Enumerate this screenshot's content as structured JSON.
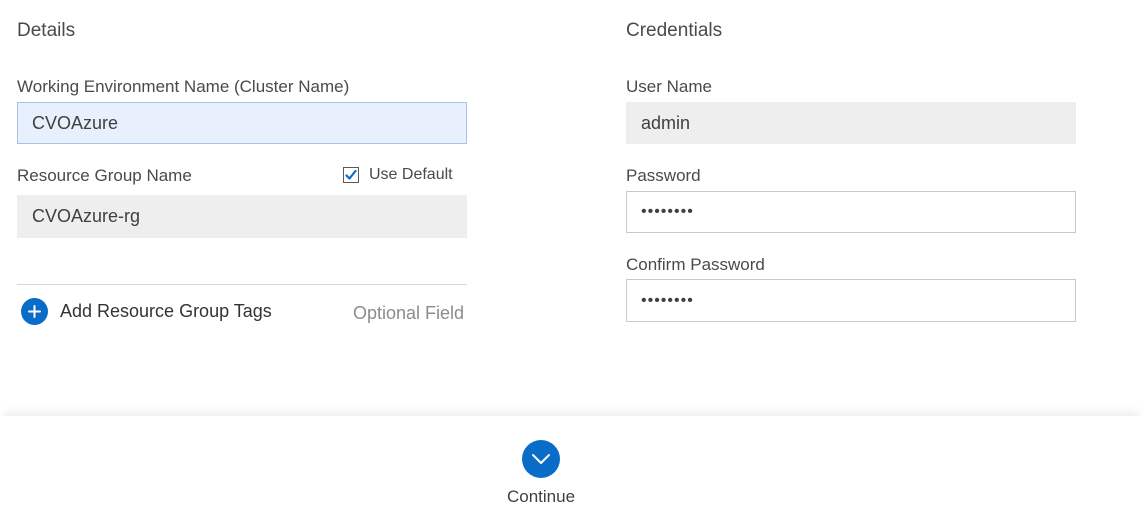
{
  "details": {
    "title": "Details",
    "working_env_label": "Working Environment Name (Cluster Name)",
    "working_env_value": "CVOAzure",
    "resource_group_label": "Resource Group Name",
    "use_default_label": "Use Default",
    "use_default_checked": true,
    "resource_group_value": "CVOAzure-rg",
    "add_tags_label": "Add Resource Group Tags",
    "optional_label": "Optional Field"
  },
  "credentials": {
    "title": "Credentials",
    "username_label": "User Name",
    "username_value": "admin",
    "password_label": "Password",
    "password_value": "••••••••",
    "confirm_password_label": "Confirm Password",
    "confirm_password_value": "••••••••"
  },
  "footer": {
    "continue_label": "Continue"
  },
  "colors": {
    "accent": "#0a6cc9",
    "active_field_bg": "#e8f0fd",
    "disabled_field_bg": "#eeeeee"
  },
  "icons": {
    "use_default_check": "checkmark-icon",
    "add_tags": "plus-circle-icon",
    "continue": "chevron-down-icon"
  }
}
